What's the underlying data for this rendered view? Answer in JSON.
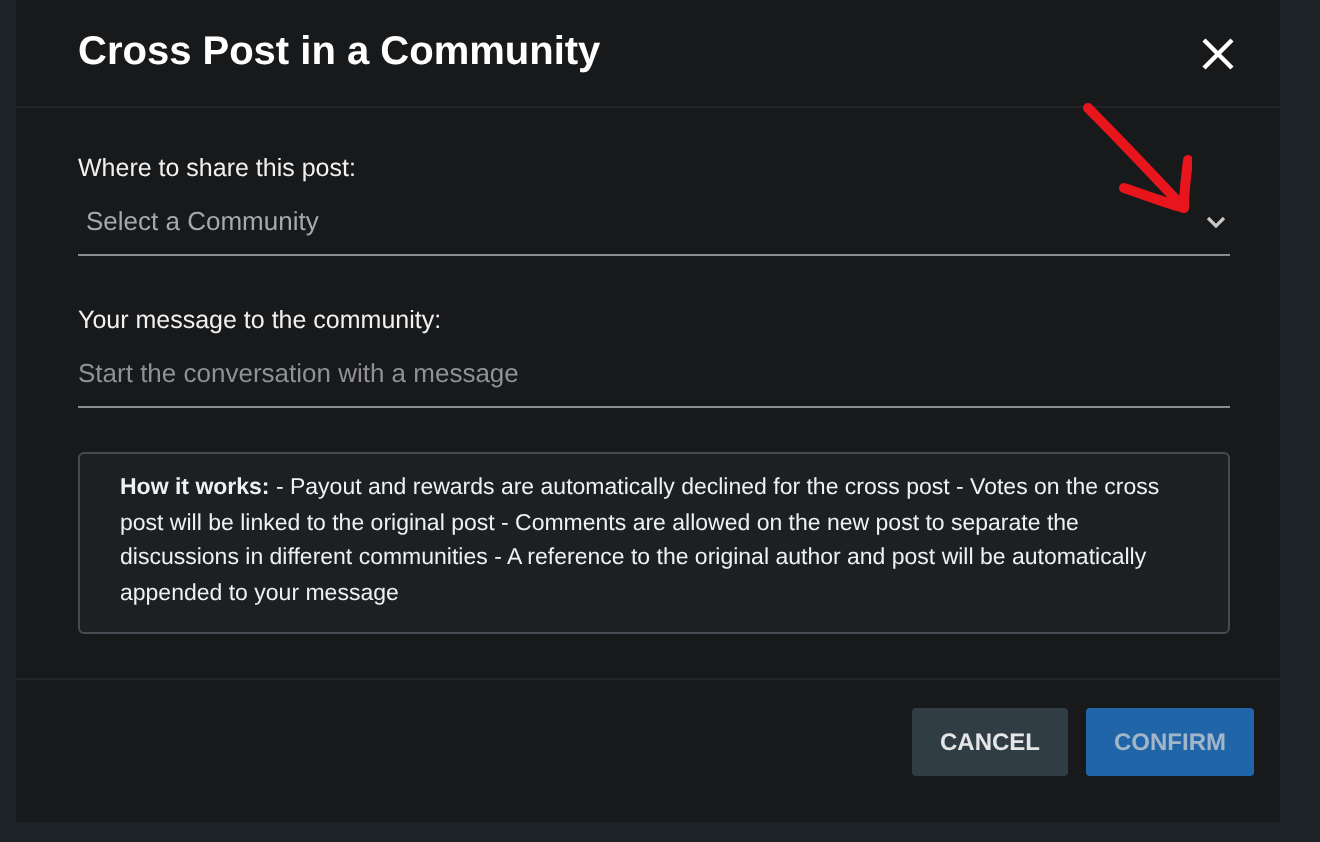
{
  "dialog": {
    "title": "Cross Post in a Community"
  },
  "community_select": {
    "label": "Where to share this post:",
    "placeholder": "Select a Community"
  },
  "message_field": {
    "label": "Your message to the community:",
    "placeholder": "Start the conversation with a message"
  },
  "info": "**How it works:** - Payout and rewards are automatically declined for the cross post - Votes on the cross post will be linked to the original post - Comments are allowed on the new post to separate the discussions in different communities - A reference to the original author and post will be automatically appended to your message",
  "buttons": [
    {
      "label": "CANCEL",
      "kind": "secondary",
      "disabled": false
    },
    {
      "label": "CONFIRM",
      "kind": "primary",
      "disabled": true
    }
  ]
}
